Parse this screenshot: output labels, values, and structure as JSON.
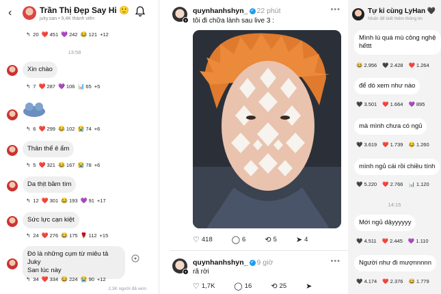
{
  "left": {
    "title": "Trần Thị Đẹp Say Hi 🙂",
    "subtitle": "juky.san • 9,4K thành viên",
    "top_reactions": {
      "reply": "20",
      "heart": "451",
      "purple": "242",
      "laugh": "121",
      "more": "+12"
    },
    "timestamp": "13:58",
    "messages": [
      {
        "text": "Xin chào",
        "reply": "7",
        "heart": "287",
        "purple": "106",
        "chart": "65",
        "more": "+5"
      },
      {
        "text": "",
        "reply": "6",
        "heart": "299",
        "laugh": "102",
        "cry": "74",
        "more": "+6"
      },
      {
        "text": "Thân thể ê ẩm",
        "reply": "5",
        "heart": "321",
        "laugh": "167",
        "cry": "78",
        "more": "+6"
      },
      {
        "text": "Da thịt bầm tím",
        "reply": "12",
        "heart": "301",
        "laugh": "193",
        "purple": "91",
        "more": "+17"
      },
      {
        "text": "Sức lực cạn kiệt",
        "reply": "24",
        "heart": "276",
        "laugh": "175",
        "flower": "112",
        "more": "+15"
      },
      {
        "text_line1": "Đó là những cụm từ miêu tả Juky",
        "text_line2": "San lúc này",
        "reply": "34",
        "heart": "334",
        "laugh": "224",
        "cry": "90",
        "more": "+12"
      }
    ],
    "seen": "2,3K người đã xem"
  },
  "mid": {
    "post1": {
      "user": "quynhanhshyn_",
      "time": "22 phút",
      "caption": "tôi đi chữa lành sau live 3 :",
      "likes": "418",
      "comments": "6",
      "reposts": "5",
      "shares": "4"
    },
    "post2": {
      "user": "quynhanhshyn_",
      "time": "9 giờ",
      "caption": "rã rời",
      "likes": "1,7K",
      "comments": "16",
      "reposts": "25"
    }
  },
  "right": {
    "title": "Tự kỉ cùng LyHan 🖤",
    "subtitle": "Nhấn để biết thêm thông tin",
    "messages": [
      {
        "line1": "Mình lú quá mù công nghệ",
        "line2": "hếttt",
        "r1": "2.956",
        "r2": "2.428",
        "r3": "1.264"
      },
      {
        "line1": "để dò xem như nào",
        "r1": "3.501",
        "r2": "1.664",
        "r3": "895"
      },
      {
        "line1": "mà mình chưa có ngủ",
        "r1": "3.619",
        "r2": "1.739",
        "r3": "1.260"
      },
      {
        "line1": "mình ngủ cái rồi chiều tính",
        "r1": "5.220",
        "r2": "2.766",
        "r3": "1.120"
      },
      {
        "line1": "Mới ngủ dậyyyyyy",
        "r1": "4.511",
        "r2": "2.445",
        "r3": "1.110"
      },
      {
        "line1": "Người như đi mượnnnnn",
        "r1": "4.174",
        "r2": "2.376",
        "r3": "1.779"
      }
    ],
    "timestamp": "14:15"
  }
}
